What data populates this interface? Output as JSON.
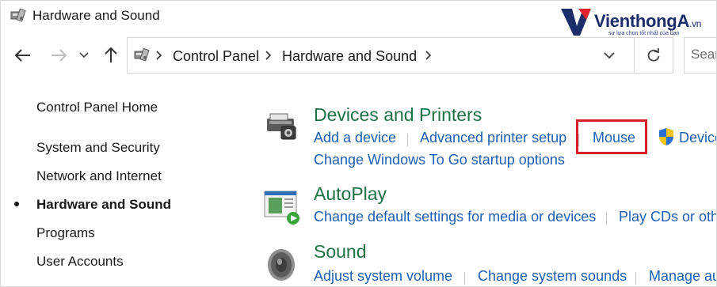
{
  "window": {
    "title": "Hardware and Sound"
  },
  "logo": {
    "brand": "VienthongA",
    "suffix": ".vn",
    "tagline": "sự lựa chọn tốt nhất của bạn",
    "colors": {
      "navy": "#1d2c6b",
      "red": "#e0242b"
    }
  },
  "nav": {
    "back_icon": "arrow-left-icon",
    "forward_icon": "arrow-right-icon",
    "recent_icon": "chevron-down-icon",
    "up_icon": "arrow-up-icon",
    "breadcrumb": [
      "Control Panel",
      "Hardware and Sound"
    ],
    "refresh_icon": "refresh-icon",
    "search_placeholder": "Sear"
  },
  "sidebar": {
    "items": [
      {
        "label": "Control Panel Home"
      },
      {
        "label": "System and Security"
      },
      {
        "label": "Network and Internet"
      },
      {
        "label": "Hardware and Sound",
        "active": true
      },
      {
        "label": "Programs"
      },
      {
        "label": "User Accounts"
      }
    ]
  },
  "categories": [
    {
      "title": "Devices and Printers",
      "icon": "printer-icon",
      "links_row1": [
        "Add a device",
        "Advanced printer setup",
        "Mouse",
        "Device"
      ],
      "links_row2": [
        "Change Windows To Go startup options"
      ]
    },
    {
      "title": "AutoPlay",
      "icon": "autoplay-icon",
      "links_row1": [
        "Change default settings for media or devices",
        "Play CDs or oth"
      ]
    },
    {
      "title": "Sound",
      "icon": "speaker-icon",
      "links_row1": [
        "Adjust system volume",
        "Change system sounds",
        "Manage au"
      ]
    }
  ],
  "colors": {
    "category_title": "#1e7145",
    "link": "#1e5fb4",
    "highlight": "#d61f26"
  }
}
